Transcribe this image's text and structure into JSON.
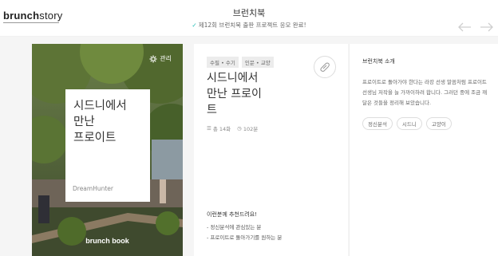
{
  "header": {
    "logo_bold": "brunch",
    "logo_light": "story",
    "title": "브런치북",
    "notice": "제12회 브런치북 출판 프로젝트 응모 완료!"
  },
  "nav": {
    "prev_icon": "arrow-left-icon",
    "next_icon": "arrow-right-icon"
  },
  "cover": {
    "manage_label": "관리",
    "title": "시드니에서\n만난\n프로이트",
    "author": "DreamHunter",
    "brand": "brunch book"
  },
  "book": {
    "tags": [
      "수필 • 수기",
      "인문 • 교양"
    ],
    "title": "시드니에서\n만난 프로이\n트",
    "episodes": "총 14화",
    "duration": "102분",
    "recommend_title": "이런분께 추천드려요!",
    "recommend_items": [
      "정신분석에 관심있는 분",
      "프로이트로 돌아가기를 원하는 분"
    ]
  },
  "intro": {
    "title": "브런치북 소개",
    "text": "프로이트로 돌아가야 한다는 라캉 선생 말씀처럼 프로이트 선생님 저작을 늘 가까이하려 합니다. 그러던 중에 조금 깨달은 것들을 정리해 보았습니다.",
    "keywords": [
      "정신분석",
      "시드니",
      "고양이"
    ]
  },
  "colors": {
    "accent": "#1bbbb4",
    "stage_bg": "#f5f5f5"
  }
}
